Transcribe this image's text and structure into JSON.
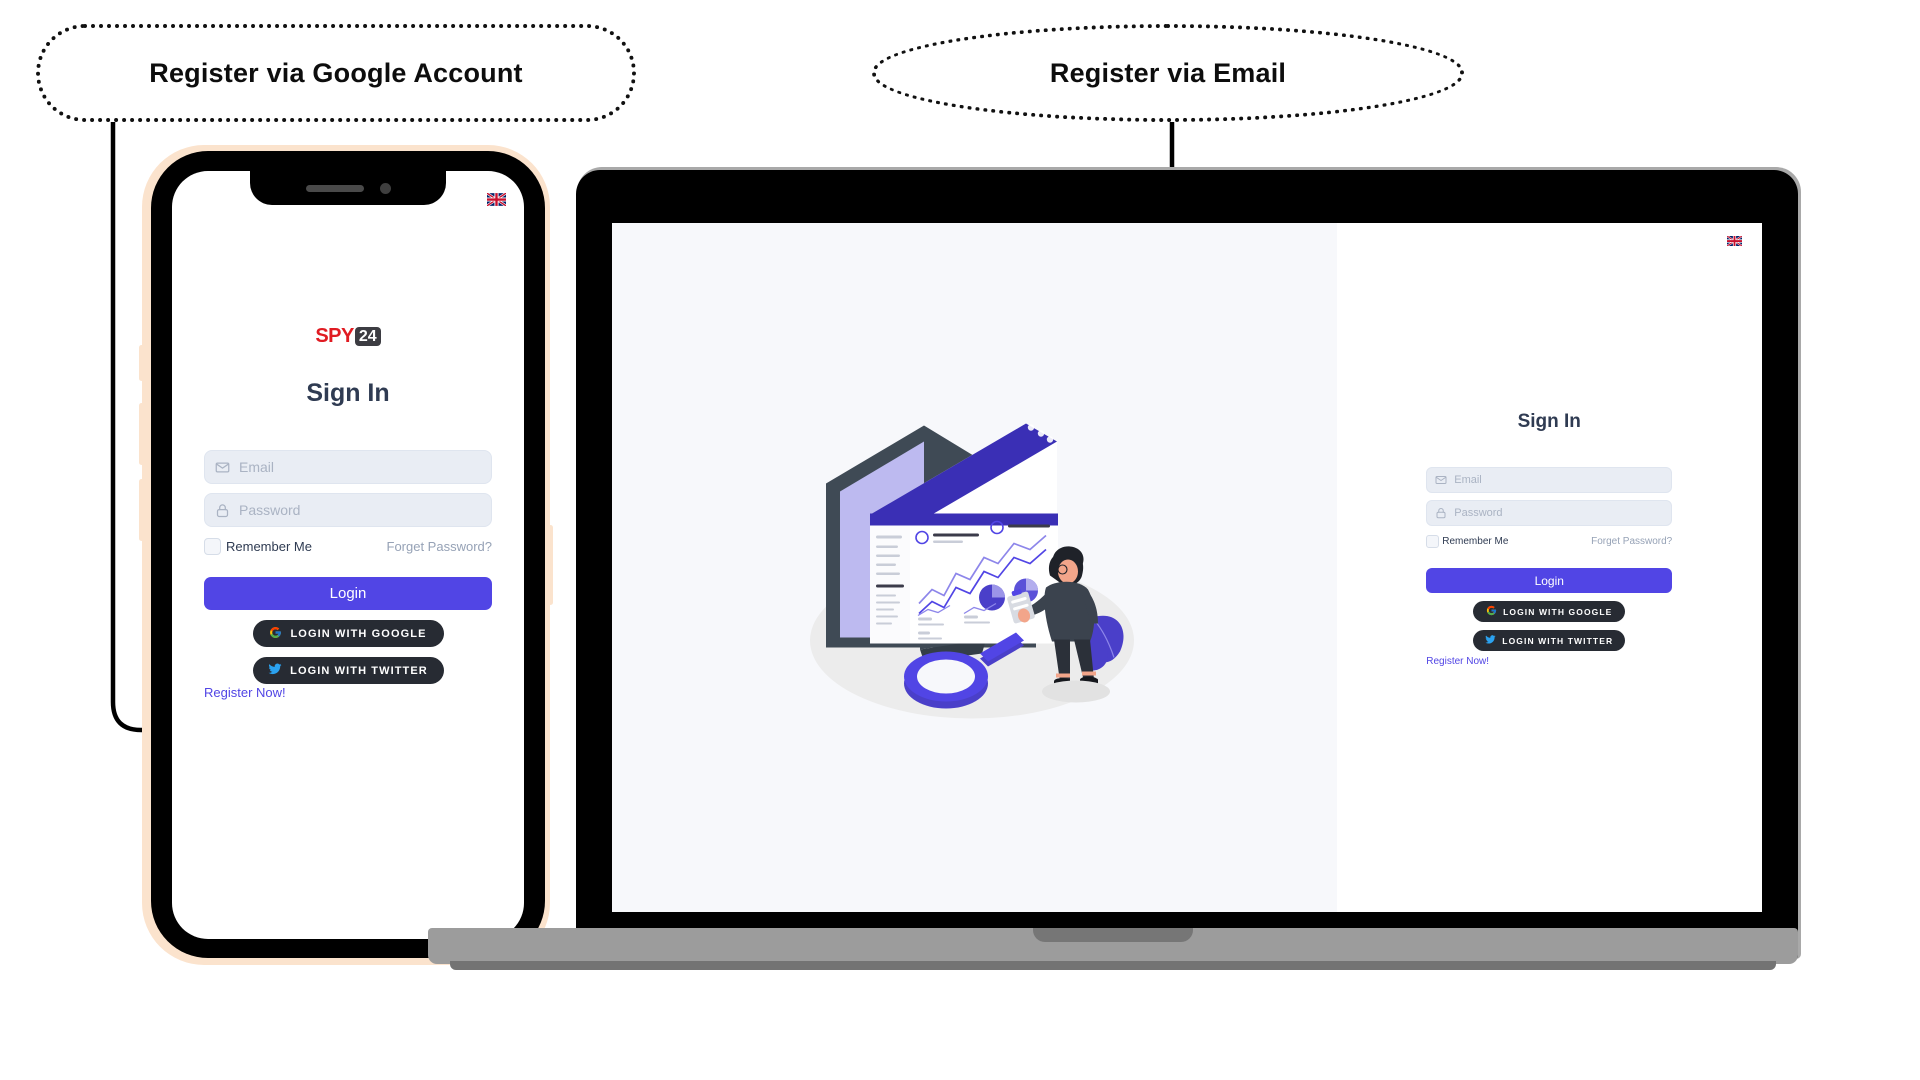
{
  "callouts": {
    "google": "Register via Google Account",
    "email": "Register via Email"
  },
  "brand": {
    "name_part1": "SPY",
    "name_part2": "24",
    "color_primary": "#e01b22",
    "color_badge": "#3c3c42"
  },
  "theme": {
    "accent": "#5145e5",
    "social_button_bg": "#272b33",
    "field_bg": "#e9edf4",
    "title_color": "#2f3b52",
    "muted_color": "#96a2b6",
    "panel_left_bg": "#f7f8fb",
    "phone_frame": "#fbe3cd"
  },
  "phone": {
    "language_flag": "uk-flag-icon",
    "title": "Sign In",
    "email": {
      "placeholder": "Email",
      "value": "",
      "icon": "envelope-icon"
    },
    "password": {
      "placeholder": "Password",
      "value": "",
      "icon": "lock-icon"
    },
    "remember_label": "Remember Me",
    "remember_checked": false,
    "forget_label": "Forget Password?",
    "login_label": "Login",
    "google_label": "LOGIN WITH GOOGLE",
    "twitter_label": "LOGIN WITH TWITTER",
    "register_label": "Register Now!"
  },
  "laptop": {
    "language_flag": "uk-flag-icon",
    "title": "Sign In",
    "email": {
      "placeholder": "Email",
      "value": "",
      "icon": "envelope-icon"
    },
    "password": {
      "placeholder": "Password",
      "value": "",
      "icon": "lock-icon"
    },
    "remember_label": "Remember Me",
    "remember_checked": false,
    "forget_label": "Forget Password?",
    "login_label": "Login",
    "google_label": "LOGIN WITH GOOGLE",
    "twitter_label": "LOGIN WITH TWITTER",
    "register_label": "Register Now!",
    "illustration": "analytics-dashboard-illustration"
  }
}
